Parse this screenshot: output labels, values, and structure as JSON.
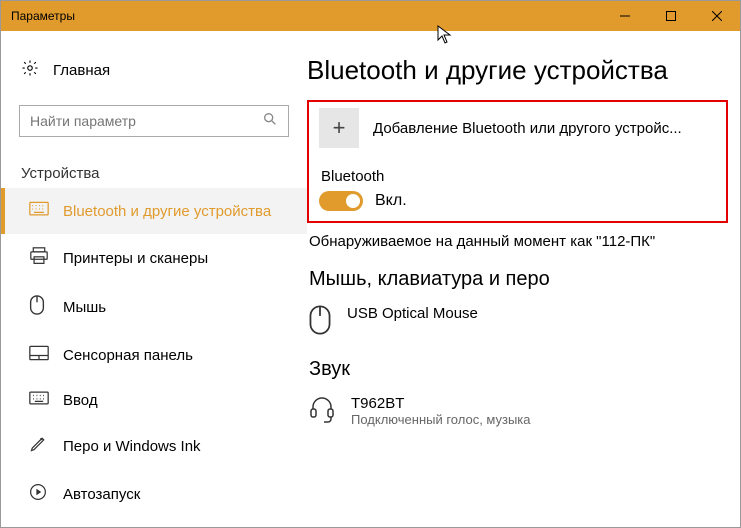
{
  "window": {
    "title": "Параметры"
  },
  "sidebar": {
    "home": "Главная",
    "search_placeholder": "Найти параметр",
    "group": "Устройства",
    "items": [
      {
        "label": "Bluetooth и другие устройства"
      },
      {
        "label": "Принтеры и сканеры"
      },
      {
        "label": "Мышь"
      },
      {
        "label": "Сенсорная панель"
      },
      {
        "label": "Ввод"
      },
      {
        "label": "Перо и Windows Ink"
      },
      {
        "label": "Автозапуск"
      }
    ]
  },
  "main": {
    "title": "Bluetooth и другие устройства",
    "add_device": "Добавление Bluetooth или другого устройс...",
    "bluetooth_label": "Bluetooth",
    "toggle_state": "Вкл.",
    "discoverable": "Обнаруживаемое на данный момент как \"112-ПК\"",
    "section_mouse": "Мышь, клавиатура и перо",
    "device_mouse": {
      "name": "USB Optical Mouse"
    },
    "section_sound": "Звук",
    "device_sound": {
      "name": "T962BT",
      "sub": "Подключенный голос, музыка"
    }
  }
}
